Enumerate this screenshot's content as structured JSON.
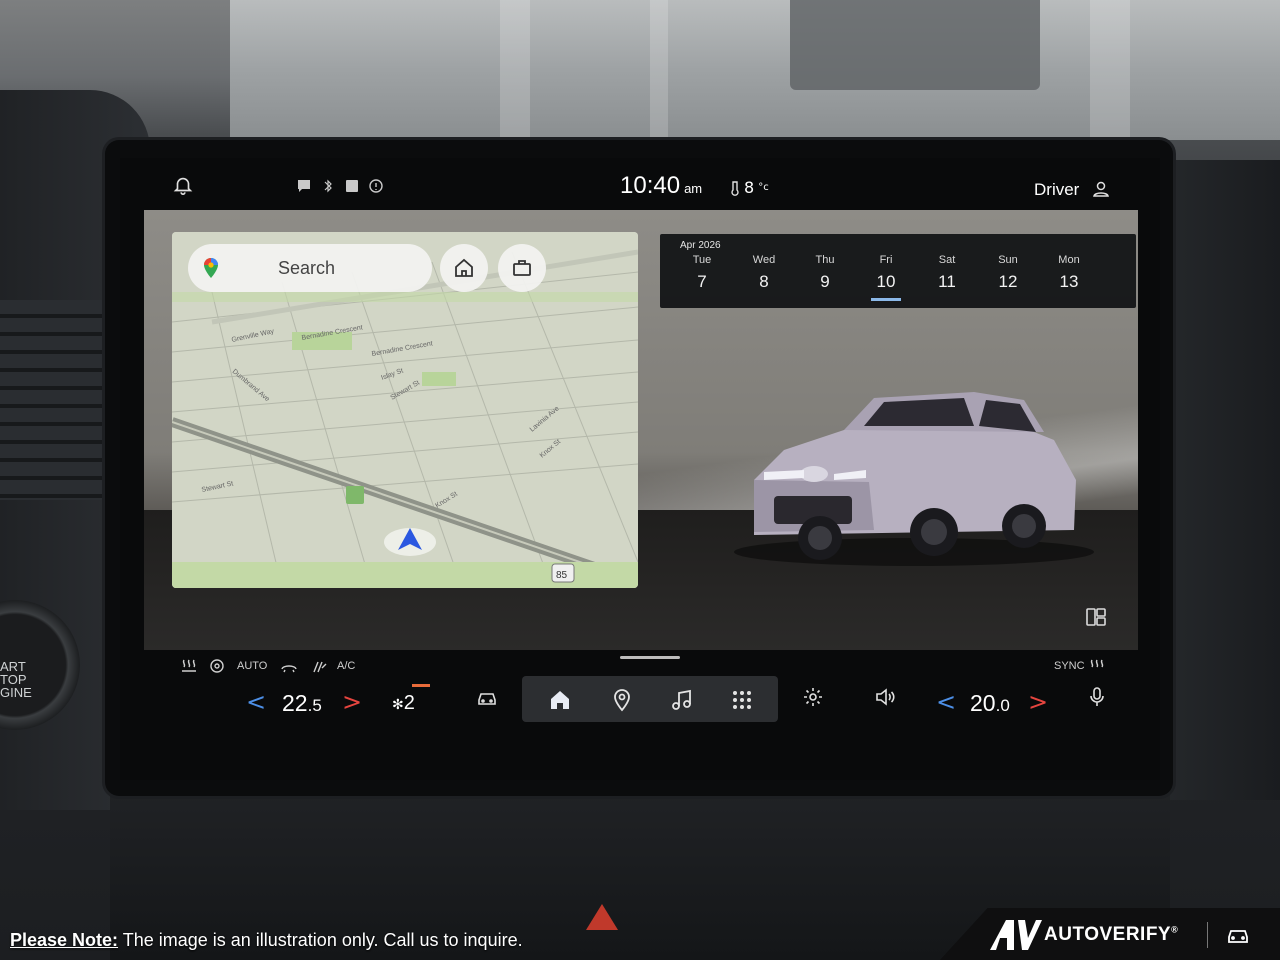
{
  "status_bar": {
    "time": "10:40",
    "ampm": "am",
    "outside_temp": "8",
    "outside_temp_unit": "°c",
    "profile": "Driver",
    "icons": [
      "bell-icon",
      "message-icon",
      "bluetooth-icon",
      "signal-icon",
      "info-icon",
      "thermometer-icon",
      "person-icon"
    ]
  },
  "map": {
    "search_label": "Search",
    "route_shield": "85",
    "streets": [
      "Stewart St",
      "Knox St",
      "Lavinia Ave",
      "Knox St",
      "Stewart St",
      "Dumbrand Ave",
      "Bernadine Crescent",
      "Bernadine Crescent",
      "Grenville Way",
      "Islay St"
    ]
  },
  "calendar": {
    "month": "Apr 2026",
    "days": [
      {
        "dow": "Tue",
        "num": "7"
      },
      {
        "dow": "Wed",
        "num": "8"
      },
      {
        "dow": "Thu",
        "num": "9"
      },
      {
        "dow": "Fri",
        "num": "10"
      },
      {
        "dow": "Sat",
        "num": "11"
      },
      {
        "dow": "Sun",
        "num": "12"
      },
      {
        "dow": "Mon",
        "num": "13"
      }
    ],
    "selected_index": 3
  },
  "climate": {
    "auto_label": "AUTO",
    "ac_label": "A/C",
    "sync_label": "SYNC",
    "driver_temp_int": "22",
    "driver_temp_dec": ".5",
    "fan_level": "2",
    "passenger_temp_int": "20",
    "passenger_temp_dec": ".0"
  },
  "colors": {
    "accent_blue": "#4d8fe6",
    "accent_red": "#e6453f",
    "selected_underline": "#8bb8e8",
    "fan_indicator": "#e86b3a"
  },
  "footer": {
    "note_label": "Please Note:",
    "note_text": " The image is an illustration only. Call us to inquire.",
    "brand": "AUTOVERIFY",
    "brand_mark": "®",
    "start_button": [
      "ART",
      "TOP",
      "GINE"
    ]
  }
}
